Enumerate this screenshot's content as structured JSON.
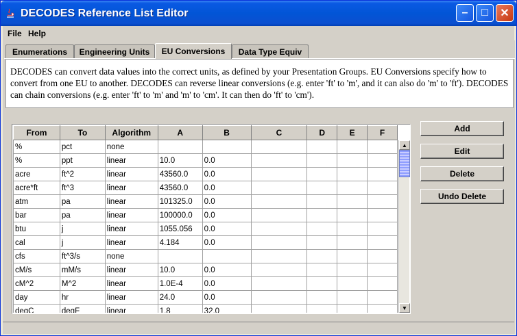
{
  "window": {
    "title": "DECODES Reference List Editor",
    "minimize_label": "–",
    "maximize_label": "□",
    "close_label": "✕"
  },
  "menu": {
    "items": [
      "File",
      "Help"
    ]
  },
  "tabs": [
    {
      "label": "Enumerations",
      "active": false
    },
    {
      "label": "Engineering Units",
      "active": false
    },
    {
      "label": "EU Conversions",
      "active": true
    },
    {
      "label": "Data Type Equiv",
      "active": false
    }
  ],
  "info_text": "DECODES can convert data values into the correct units, as defined by your Presentation Groups. EU Conversions specify how to convert from one EU to another. DECODES can reverse linear conversions (e.g. enter 'ft' to 'm', and it can also do 'm' to 'ft'). DECODES can chain conversions (e.g. enter 'ft' to 'm' and 'm' to 'cm'. It can then do 'ft' to 'cm').",
  "table": {
    "columns": [
      "From",
      "To",
      "Algorithm",
      "A",
      "B",
      "C",
      "D",
      "E",
      "F"
    ],
    "rows": [
      [
        "%",
        "pct",
        "none",
        "",
        "",
        "",
        "",
        "",
        ""
      ],
      [
        "%",
        "ppt",
        "linear",
        "10.0",
        "0.0",
        "",
        "",
        "",
        ""
      ],
      [
        "acre",
        "ft^2",
        "linear",
        "43560.0",
        "0.0",
        "",
        "",
        "",
        ""
      ],
      [
        "acre*ft",
        "ft^3",
        "linear",
        "43560.0",
        "0.0",
        "",
        "",
        "",
        ""
      ],
      [
        "atm",
        "pa",
        "linear",
        "101325.0",
        "0.0",
        "",
        "",
        "",
        ""
      ],
      [
        "bar",
        "pa",
        "linear",
        "100000.0",
        "0.0",
        "",
        "",
        "",
        ""
      ],
      [
        "btu",
        "j",
        "linear",
        "1055.056",
        "0.0",
        "",
        "",
        "",
        ""
      ],
      [
        "cal",
        "j",
        "linear",
        "4.184",
        "0.0",
        "",
        "",
        "",
        ""
      ],
      [
        "cfs",
        "ft^3/s",
        "none",
        "",
        "",
        "",
        "",
        "",
        ""
      ],
      [
        "cM/s",
        "mM/s",
        "linear",
        "10.0",
        "0.0",
        "",
        "",
        "",
        ""
      ],
      [
        "cM^2",
        "M^2",
        "linear",
        "1.0E-4",
        "0.0",
        "",
        "",
        "",
        ""
      ],
      [
        "day",
        "hr",
        "linear",
        "24.0",
        "0.0",
        "",
        "",
        "",
        ""
      ],
      [
        "degC",
        "degF",
        "linear",
        "1.8",
        "32.0",
        "",
        "",
        "",
        ""
      ]
    ]
  },
  "buttons": {
    "add": "Add",
    "edit": "Edit",
    "delete": "Delete",
    "undo_delete": "Undo Delete"
  },
  "colors": {
    "titlebar": "#0255d6",
    "panel": "#d4d0c8"
  }
}
